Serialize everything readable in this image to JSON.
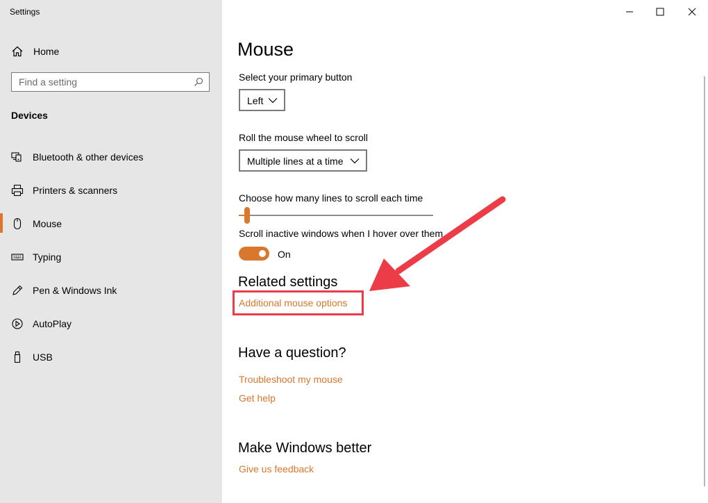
{
  "window": {
    "title": "Settings"
  },
  "sidebar": {
    "home_label": "Home",
    "search_placeholder": "Find a setting",
    "section_title": "Devices",
    "items": [
      {
        "label": "Bluetooth & other devices",
        "icon": "bluetooth-devices-icon"
      },
      {
        "label": "Printers & scanners",
        "icon": "printer-icon"
      },
      {
        "label": "Mouse",
        "icon": "mouse-icon",
        "active": true
      },
      {
        "label": "Typing",
        "icon": "keyboard-icon"
      },
      {
        "label": "Pen & Windows Ink",
        "icon": "pen-icon"
      },
      {
        "label": "AutoPlay",
        "icon": "autoplay-icon"
      },
      {
        "label": "USB",
        "icon": "usb-icon"
      }
    ]
  },
  "main": {
    "title": "Mouse",
    "primary_button": {
      "label": "Select your primary button",
      "value": "Left"
    },
    "wheel_scroll": {
      "label": "Roll the mouse wheel to scroll",
      "value": "Multiple lines at a time"
    },
    "scroll_lines": {
      "label": "Choose how many lines to scroll each time",
      "level": 0.03
    },
    "inactive_scroll": {
      "label": "Scroll inactive windows when I hover over them",
      "state": "On",
      "enabled": true
    },
    "related": {
      "heading": "Related settings",
      "link": "Additional mouse options"
    },
    "question": {
      "heading": "Have a question?",
      "links": [
        "Troubleshoot my mouse",
        "Get help"
      ]
    },
    "feedback": {
      "heading": "Make Windows better",
      "link": "Give us feedback"
    }
  },
  "colors": {
    "accent": "#d9772d",
    "annotation": "#ec3c47",
    "sidebar_bg": "#e6e6e6"
  }
}
